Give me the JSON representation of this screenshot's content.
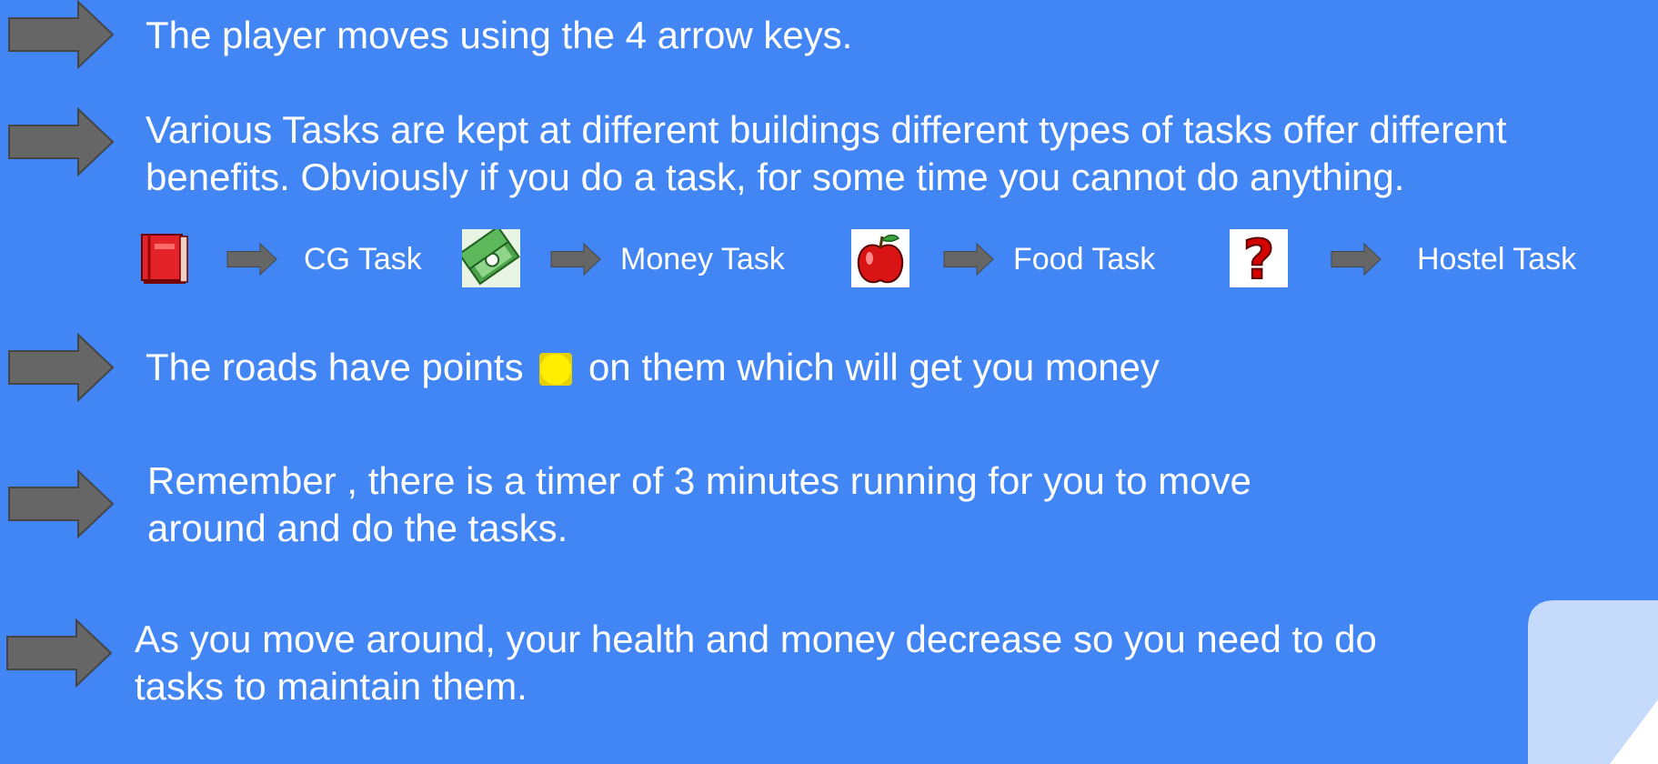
{
  "lines": {
    "movement": "The player moves using the 4 arrow keys.",
    "tasks_line1": "Various Tasks are kept at different buildings different types of tasks offer different",
    "tasks_line2": "benefits. Obviously if you do a task, for some time you cannot do anything.",
    "points_before": "The roads have points",
    "points_after": "on them which will get you money",
    "timer_line1": "Remember , there is a timer of 3 minutes running for you to move",
    "timer_line2": "around and do the tasks.",
    "health_line1": "As you move around, your health and money decrease so you need to do",
    "health_line2": "tasks to maintain them."
  },
  "legend": [
    {
      "icon": "book-icon",
      "label": "CG Task"
    },
    {
      "icon": "money-icon",
      "label": "Money Task"
    },
    {
      "icon": "apple-icon",
      "label": "Food Task"
    },
    {
      "icon": "question-mark-icon",
      "label": "Hostel Task"
    }
  ],
  "colors": {
    "background": "#4285f4",
    "text": "#ffffff",
    "arrow_fill": "#666666",
    "point_color": "#ffee00",
    "corner": "#c6dafc"
  }
}
